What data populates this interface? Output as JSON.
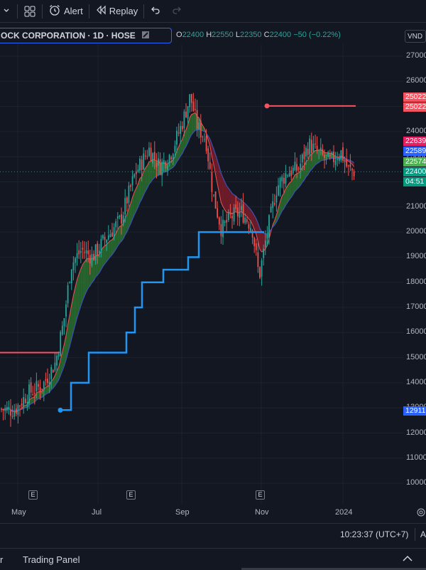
{
  "toolbar": {
    "alert_label": "Alert",
    "replay_label": "Replay"
  },
  "legend": {
    "symbol_title": "OCK CORPORATION · 1D · HOSE",
    "open_key": "O",
    "open_val": "22400",
    "high_key": "H",
    "high_val": "22550",
    "low_key": "L",
    "low_val": "22350",
    "close_key": "C",
    "close_val": "22400",
    "change": "−50 (−0.22%)"
  },
  "currency": "VND",
  "price_axis": [
    "27000",
    "26000",
    "25000",
    "24000",
    "23000",
    "22000",
    "21000",
    "20000",
    "19000",
    "18000",
    "17000",
    "16000",
    "15000",
    "14000",
    "13000",
    "12000",
    "11000",
    "10000"
  ],
  "price_tags": [
    {
      "text": "25022",
      "color": "#f7525f"
    },
    {
      "text": "25022",
      "color": "#f7525f"
    },
    {
      "text": "22639",
      "color": "#e91e63"
    },
    {
      "text": "22589",
      "color": "#2962ff"
    },
    {
      "text": "22574",
      "color": "#4caf50"
    },
    {
      "text": "22400",
      "color": "#089981"
    },
    {
      "text": "04:51",
      "color": "#089981"
    },
    {
      "text": "12911",
      "color": "#2962ff"
    }
  ],
  "time_axis": [
    "May",
    "Jul",
    "Sep",
    "Nov",
    "2024"
  ],
  "earnings_mark": "E",
  "status": {
    "clock": "10:23:37 (UTC+7)",
    "right_cut": "A"
  },
  "bottom": {
    "left_cut": "r",
    "trading_panel": "Trading Panel"
  },
  "chart_data": {
    "type": "candlestick",
    "x_ticks": [
      "May",
      "Jul",
      "Sep",
      "Nov",
      "2024"
    ],
    "y_range": [
      9500,
      27300
    ],
    "last_close": 22400,
    "approx_close_path": [
      {
        "t": "Apr",
        "v": 13000
      },
      {
        "t": "May",
        "v": 13800
      },
      {
        "t": "Jun",
        "v": 15000
      },
      {
        "t": "Jun-end",
        "v": 18500
      },
      {
        "t": "Jul",
        "v": 19500
      },
      {
        "t": "Aug",
        "v": 22500
      },
      {
        "t": "Sep",
        "v": 25500
      },
      {
        "t": "Sep-mid",
        "v": 23500
      },
      {
        "t": "Oct",
        "v": 20000
      },
      {
        "t": "Oct-mid",
        "v": 20500
      },
      {
        "t": "Nov",
        "v": 17500
      },
      {
        "t": "Nov-mid",
        "v": 21500
      },
      {
        "t": "Dec",
        "v": 23800
      },
      {
        "t": "Dec-mid",
        "v": 22600
      },
      {
        "t": "2024",
        "v": 22400
      }
    ],
    "stop_line_levels": [
      12911,
      14000,
      15200,
      16000,
      17000,
      18000,
      18500,
      19000,
      20000
    ],
    "resistance_levels": [
      25022,
      15200
    ],
    "colors": {
      "up": "#26a69a",
      "down": "#ef5350",
      "band_up": "#2e7d32",
      "band_down": "#8b1e2b",
      "stop": "#2196f3",
      "resistance": "#f7525f"
    }
  }
}
